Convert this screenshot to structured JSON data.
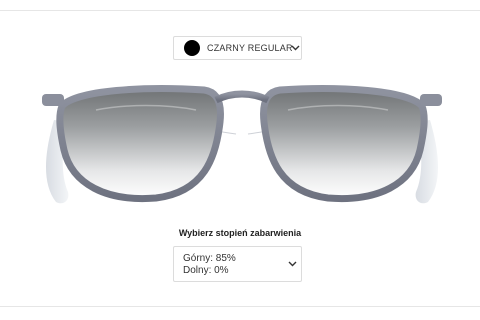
{
  "color_selector": {
    "swatch_color": "#000000",
    "label": "CZARNY REGULAR",
    "icon": "chevron-down-icon"
  },
  "product": {
    "frame_color": "#8b8f9c",
    "lens_top_color": "#7d8082",
    "lens_bottom_color": "#ffffff"
  },
  "tint": {
    "title": "Wybierz stopień zabarwienia",
    "top_label": "Górny: 85%",
    "bottom_label": "Dolny: 0%",
    "icon": "chevron-down-icon"
  }
}
